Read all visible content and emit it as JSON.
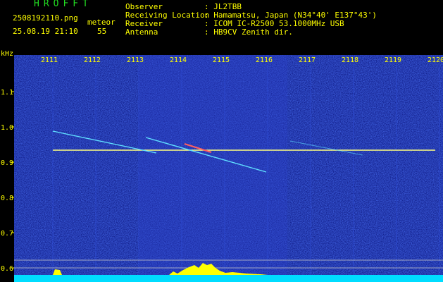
{
  "header": {
    "app_title": "HROFFT",
    "file_name": "2508192110.png",
    "mode": "meteor",
    "timestamp": "25.08.19 21:10",
    "count": "55",
    "info": [
      {
        "label": "Observer",
        "value": ": JL2TBB"
      },
      {
        "label": "Receiving Location",
        "value": ": Hamamatsu, Japan (N34°40' E137°43')"
      },
      {
        "label": "Receiver",
        "value": ": ICOM IC-R2500 53.1000MHz USB"
      },
      {
        "label": "Antenna",
        "value": ": HB9CV Zenith dir."
      }
    ]
  },
  "axis": {
    "unit": "kHz",
    "time_ticks": [
      "2111",
      "2112",
      "2113",
      "2114",
      "2115",
      "2116",
      "2117",
      "2118",
      "2119",
      "2120"
    ],
    "freq_ticks": [
      "1.1",
      "1.0",
      "0.9",
      "0.8",
      "0.7",
      "0.6"
    ]
  },
  "colors": {
    "text": "#ffff00",
    "title": "#22dd22",
    "background_noise": "#1020a0",
    "carrier": "#ffff80",
    "baseline": "#00ddff"
  }
}
